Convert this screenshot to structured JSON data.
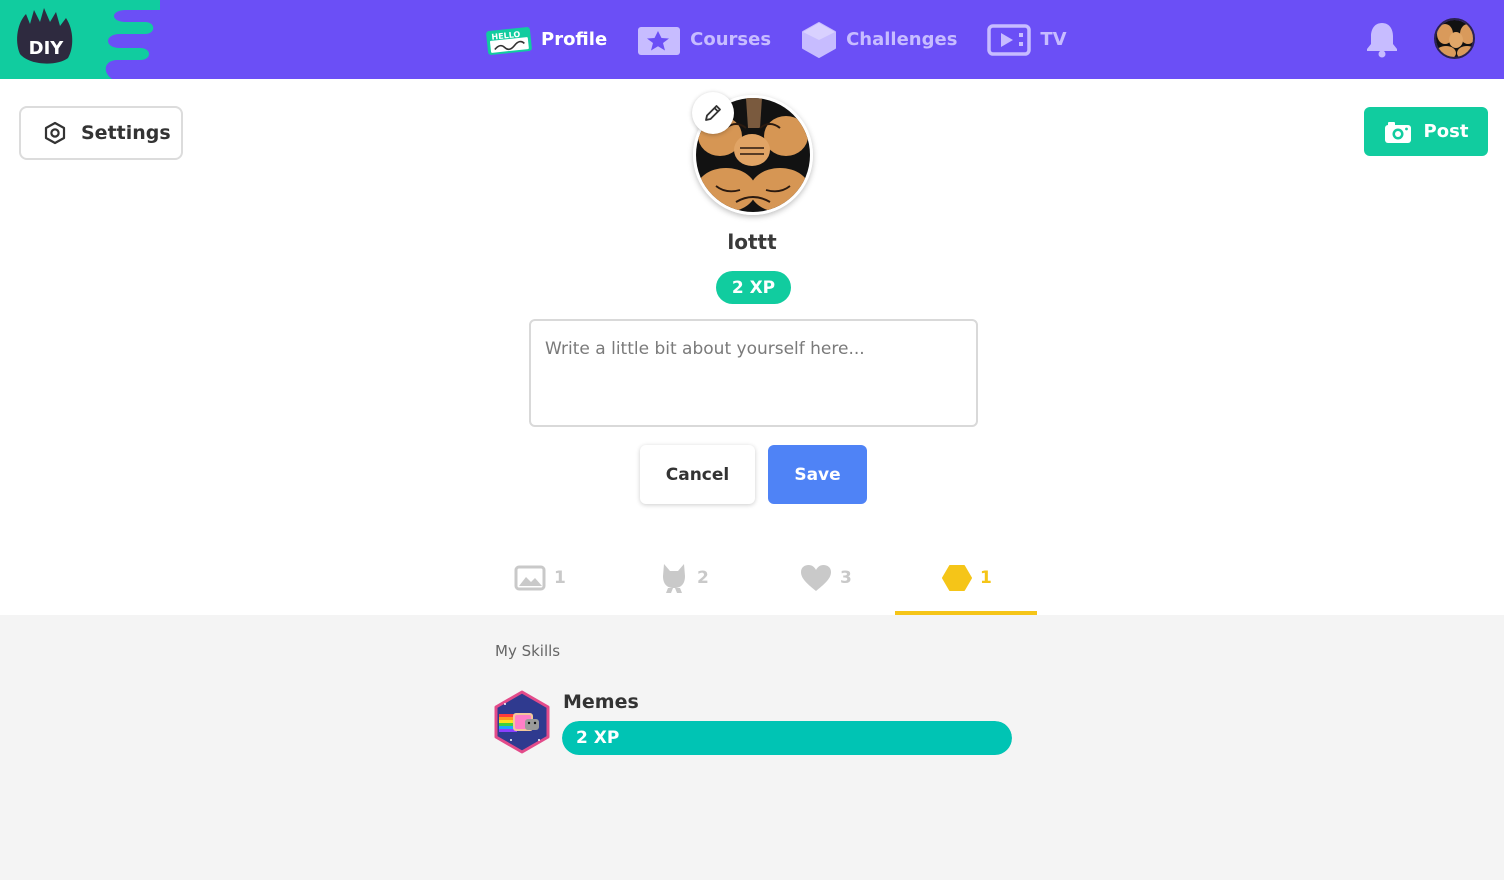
{
  "header": {
    "logo_text": "DIY",
    "nav": [
      {
        "label": "Profile",
        "icon": "hello-name-tag-icon",
        "active": true
      },
      {
        "label": "Courses",
        "icon": "star-card-icon",
        "active": false
      },
      {
        "label": "Challenges",
        "icon": "hexagon-icon",
        "active": false
      },
      {
        "label": "TV",
        "icon": "tv-play-icon",
        "active": false
      }
    ],
    "notifications_icon": "bell-icon"
  },
  "profile": {
    "settings_label": "Settings",
    "post_label": "Post",
    "username": "lottt",
    "xp": "2 XP",
    "bio_placeholder": "Write a little bit about yourself here...",
    "bio_value": "",
    "cancel_label": "Cancel",
    "save_label": "Save"
  },
  "tabs": [
    {
      "icon": "image-icon",
      "count": "1",
      "active": false
    },
    {
      "icon": "cat-icon",
      "count": "2",
      "active": false
    },
    {
      "icon": "heart-icon",
      "count": "3",
      "active": false
    },
    {
      "icon": "hexagon-icon",
      "count": "1",
      "active": true
    }
  ],
  "skills": {
    "title": "My Skills",
    "items": [
      {
        "name": "Memes",
        "xp": "2 XP",
        "progress": 1.0,
        "badge_icon": "nyan-cat-badge-icon"
      }
    ]
  },
  "colors": {
    "nav_bg": "#6b4ff6",
    "logo_green": "#11cc9f",
    "xp_green": "#11cc9f",
    "save_blue": "#4f83f6",
    "tab_active": "#f5c518",
    "skill_bar": "#00c4b4"
  }
}
